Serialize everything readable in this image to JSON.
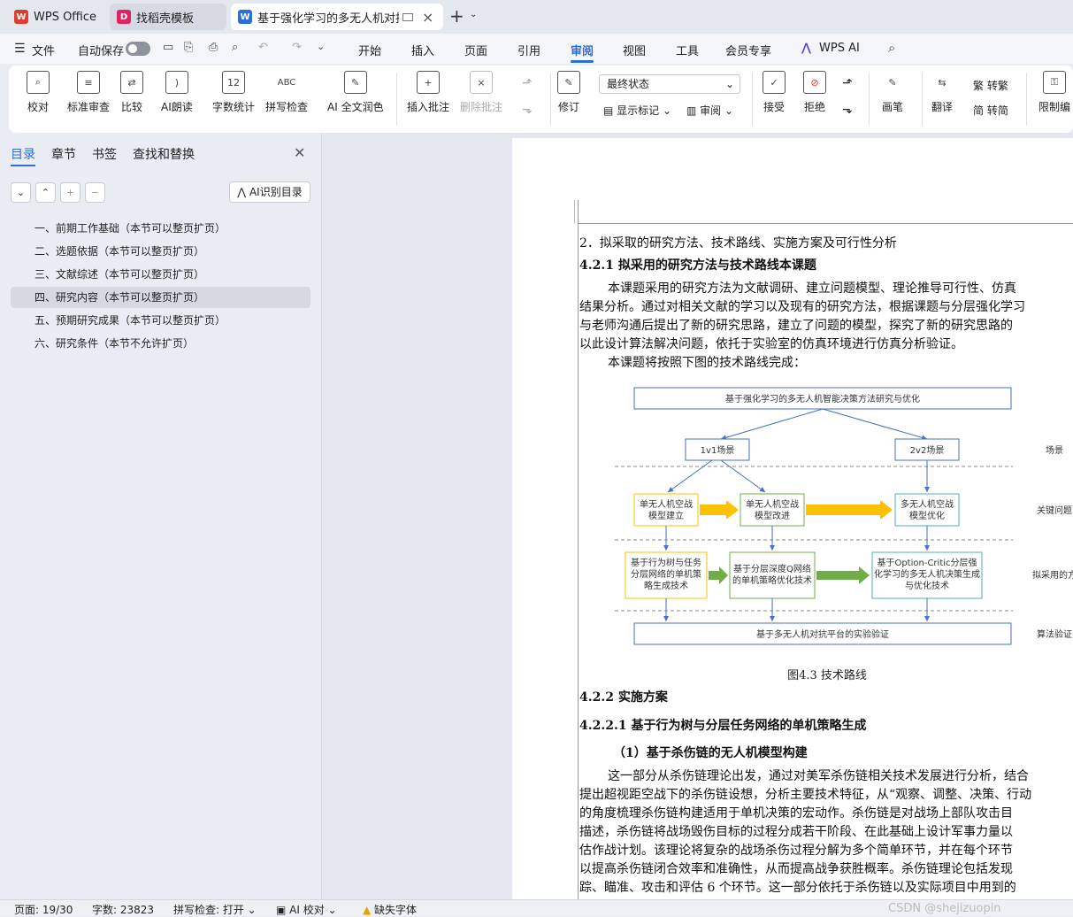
{
  "tabs": [
    {
      "label": "WPS Office",
      "icon": "wps-logo-icon"
    },
    {
      "label": "找稻壳模板",
      "icon": "docer-icon"
    },
    {
      "label": "基于强化学习的多无人机对抗",
      "icon": "word-doc-icon",
      "close": "×"
    }
  ],
  "tab_add": "+",
  "menu": {
    "file": "文件",
    "autosave": "自动保存",
    "items": [
      "开始",
      "插入",
      "页面",
      "引用",
      "审阅",
      "视图",
      "工具",
      "会员专享"
    ],
    "active": "审阅",
    "wps_ai": "WPS AI"
  },
  "ribbon": {
    "buttons": [
      {
        "label": "校对",
        "icon": "proofread-icon"
      },
      {
        "label": "标准审查",
        "icon": "standard-review-icon"
      },
      {
        "label": "比较",
        "icon": "compare-icon"
      },
      {
        "label": "AI朗读",
        "icon": "ai-read-icon"
      },
      {
        "label": "字数统计",
        "icon": "word-count-icon",
        "glyph": "12"
      },
      {
        "label": "拼写检查",
        "icon": "spell-check-icon",
        "glyph": "ABC"
      },
      {
        "label": "AI 全文润色",
        "icon": "ai-polish-icon"
      },
      {
        "label": "插入批注",
        "icon": "insert-comment-icon"
      },
      {
        "label": "删除批注",
        "icon": "delete-comment-icon"
      },
      {
        "label": "修订",
        "icon": "track-changes-icon"
      },
      {
        "label": "接受",
        "icon": "accept-icon"
      },
      {
        "label": "拒绝",
        "icon": "reject-icon"
      },
      {
        "label": "画笔",
        "icon": "pen-icon"
      },
      {
        "label": "翻译",
        "icon": "translate-icon"
      },
      {
        "label": "限制编",
        "icon": "restrict-edit-icon"
      }
    ],
    "status_select": "最终状态",
    "show_markup": "显示标记",
    "review": "审阅",
    "to_traditional": "转繁",
    "to_simplified": "转简"
  },
  "sidebar": {
    "tabs": [
      "目录",
      "章节",
      "书签",
      "查找和替换"
    ],
    "active_tab": "目录",
    "ai_toc": "AI识别目录",
    "toc": [
      "一、前期工作基础（本节可以整页扩页）",
      "二、选题依据（本节可以整页扩页）",
      "三、文献综述（本节可以整页扩页）",
      "四、研究内容（本节可以整页扩页）",
      "五、预期研究成果（本节可以整页扩页）",
      "六、研究条件（本节不允许扩页）"
    ],
    "selected_index": 3
  },
  "document": {
    "section_title": "2．拟采取的研究方法、技术路线、实施方案及可行性分析",
    "h_421": "4.2.1 拟采用的研究方法与技术路线本课题",
    "p1": [
      "本课题采用的研究方法为文献调研、建立问题模型、理论推导可行性、仿真",
      "结果分析。通过对相关文献的学习以及现有的研究方法，根据课题与分层强化学习",
      "与老师沟通后提出了新的研究思路，建立了问题的模型，探究了新的研究思路的",
      "以此设计算法解决问题，依托于实验室的仿真环境进行仿真分析验证。"
    ],
    "p2": "本课题将按照下图的技术路线完成：",
    "fig_caption": "图4.3  技术路线",
    "h_422": "4.2.2 实施方案",
    "h_4221": "4.2.2.1 基于行为树与分层任务网络的单机策略生成",
    "h_sub1": "（1）基于杀伤链的无人机模型构建",
    "p3": [
      "这一部分从杀伤链理论出发，通过对美军杀伤链相关技术发展进行分析，结合",
      "提出超视距空战下的杀伤链设想，分析主要技术特征，从“观察、调整、决策、行动",
      "的角度梳理杀伤链构建适用于单机决策的宏动作。杀伤链是对战场上部队攻击目",
      "描述，杀伤链将战场毁伤目标的过程分成若干阶段、在此基础上设计军事力量以",
      "估作战计划。该理论将复杂的战场杀伤过程分解为多个简单环节，并在每个环节",
      "以提高杀伤链闭合效率和准确性，从而提高战争获胜概率。杀伤链理论包括发现",
      "踪、瞄准、攻击和评估 6 个环节。这一部分依托于杀伤链以及实际项目中用到的"
    ]
  },
  "flow": {
    "top": "基于强化学习的多无人机智能决策方法研究与优化",
    "scene1": "1v1场景",
    "scene2": "2v2场景",
    "k1": [
      "单无人机空战",
      "模型建立"
    ],
    "k2": [
      "单无人机空战",
      "模型改进"
    ],
    "k3": [
      "多无人机空战",
      "模型优化"
    ],
    "m1": [
      "基于行为树与任务",
      "分层网络的单机策",
      "略生成技术"
    ],
    "m2": [
      "基于分层深度Q网络",
      "的单机策略优化技术"
    ],
    "m3": [
      "基于Option-Critic分层强",
      "化学习的多无人机决策生成",
      "与优化技术"
    ],
    "bottom": "基于多无人机对抗平台的实验验证",
    "side": [
      "场景",
      "关键问题",
      "拟采用的方",
      "算法验证"
    ],
    "colors": {
      "blue": "#4472c4",
      "yellow": "#ffc000",
      "green": "#70ad47",
      "teal": "#4bacc6",
      "accent": "#2a6fd6"
    }
  },
  "status": {
    "page": "页面: 19/30",
    "words": "字数: 23823",
    "spell": "拼写检查: 打开",
    "ai_check": "AI 校对",
    "missing_font": "缺失字体",
    "watermark": "CSDN @shejizuopin"
  }
}
